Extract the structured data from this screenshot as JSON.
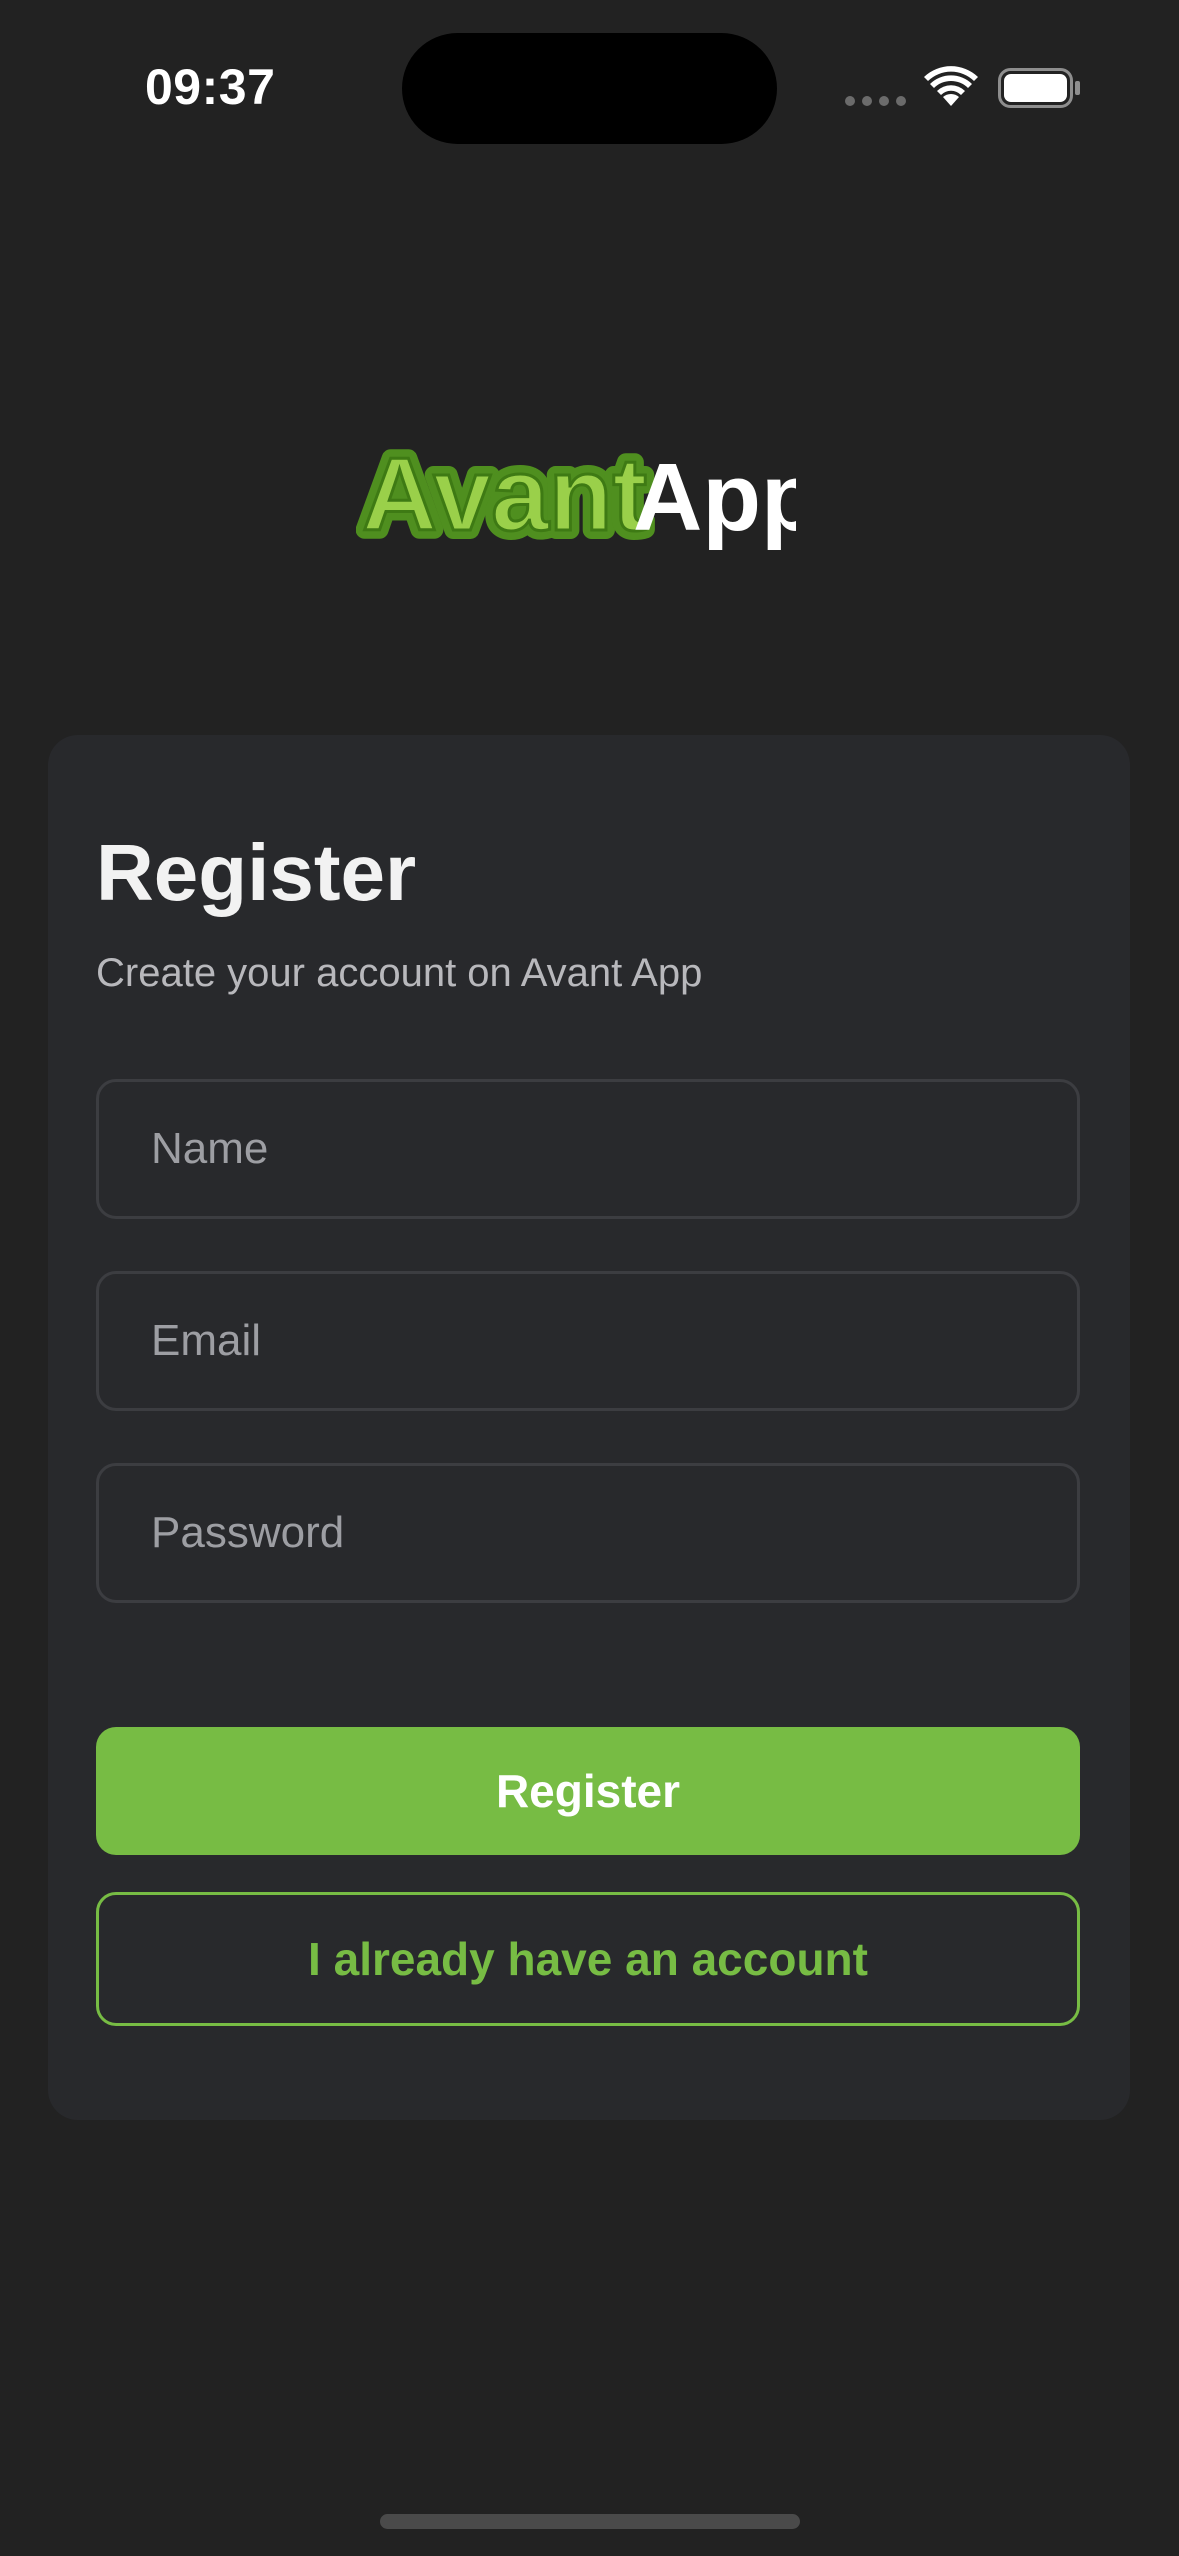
{
  "status_bar": {
    "time": "09:37"
  },
  "logo": {
    "part1": "Avant",
    "part2": "App",
    "accent_color": "#77bc44",
    "accent_dark": "#4f8f1f"
  },
  "card": {
    "title": "Register",
    "subtitle": "Create your account on Avant App"
  },
  "form": {
    "name_placeholder": "Name",
    "email_placeholder": "Email",
    "password_placeholder": "Password"
  },
  "buttons": {
    "register_label": "Register",
    "login_label": "I already have an account"
  },
  "colors": {
    "background": "#222222",
    "card": "#28292c",
    "primary": "#77bc44"
  },
  "icons": [
    "signal-icon",
    "wifi-icon",
    "battery-icon"
  ]
}
